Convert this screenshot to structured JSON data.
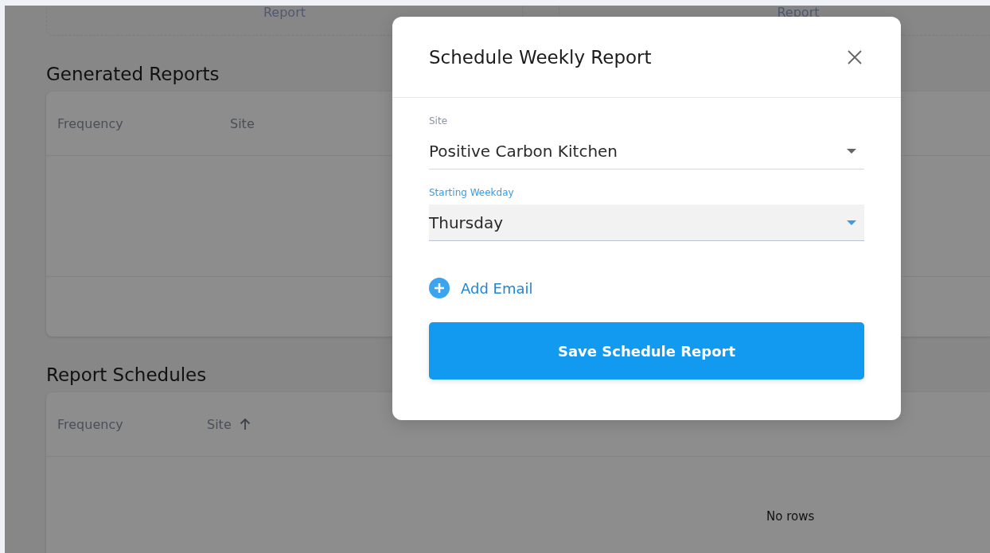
{
  "background": {
    "report_cards": [
      {
        "label": "Report"
      },
      {
        "label": "Report"
      }
    ],
    "generated_reports": {
      "title": "Generated Reports",
      "columns": [
        {
          "label": "Frequency",
          "sorted": false
        },
        {
          "label": "Site",
          "sorted": false
        }
      ]
    },
    "report_schedules": {
      "title": "Report Schedules",
      "columns": [
        {
          "label": "Frequency",
          "sorted": false
        },
        {
          "label": "Site",
          "sorted": true
        }
      ],
      "empty_message": "No rows"
    }
  },
  "dialog": {
    "title": "Schedule Weekly Report",
    "fields": [
      {
        "label": "Site",
        "value": "Positive Carbon Kitchen",
        "focused": false
      },
      {
        "label": "Starting Weekday",
        "value": "Thursday",
        "focused": true
      }
    ],
    "add_link": "Add Email",
    "submit": "Save Schedule Report"
  }
}
